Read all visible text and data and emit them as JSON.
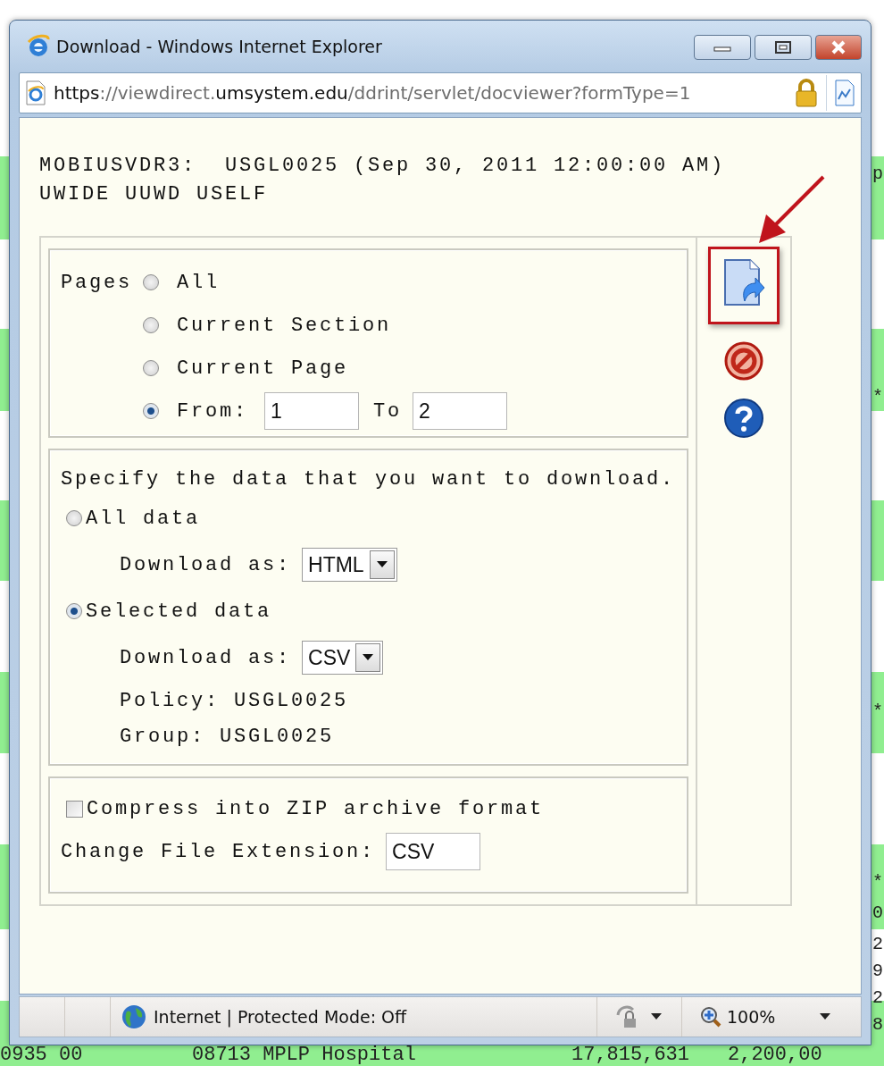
{
  "background": {
    "right_edge": [
      "p",
      "*",
      "*",
      "*",
      "0",
      "2",
      "9",
      "2",
      "8"
    ],
    "bottom_row": [
      "0935 00",
      "08713 MPLP Hospital",
      "17,815,631",
      "2,200,00"
    ]
  },
  "window": {
    "title": "Download - Windows Internet Explorer",
    "address": [
      {
        "text": "https",
        "dim": false
      },
      {
        "text": "://viewdirect.",
        "dim": true
      },
      {
        "text": "umsystem.edu",
        "dim": false
      },
      {
        "text": "/ddrint/servlet/docviewer?formType=1",
        "dim": true
      }
    ]
  },
  "header": [
    "MOBIUSVDR3:  USGL0025 (Sep 30, 2011 12:00:00 AM)",
    "UWIDE UUWD USELF"
  ],
  "pages": {
    "label": "Pages",
    "options": [
      {
        "label": "All",
        "selected": false,
        "kind": "plain"
      },
      {
        "label": "Current Section",
        "selected": false,
        "kind": "plain"
      },
      {
        "label": "Current Page",
        "selected": false,
        "kind": "plain"
      },
      {
        "label": "From:",
        "selected": true,
        "kind": "range"
      }
    ],
    "from": "1",
    "to_label": "To",
    "to": "2"
  },
  "data": {
    "prompt": "Specify the data that you want to download.",
    "options": [
      {
        "label": "All data",
        "selected": false,
        "download_label": "Download as:",
        "format": "HTML"
      },
      {
        "label": "Selected data",
        "selected": true,
        "download_label": "Download as:",
        "format": "CSV",
        "details": [
          "Policy: USGL0025",
          "Group: USGL0025"
        ]
      }
    ]
  },
  "compress": {
    "label": "Compress into ZIP archive format",
    "checked": false
  },
  "extension": {
    "label": "Change File Extension:",
    "value": "CSV"
  },
  "status_bar": {
    "zone": "Internet | Protected Mode: Off",
    "zoom": "100%"
  }
}
